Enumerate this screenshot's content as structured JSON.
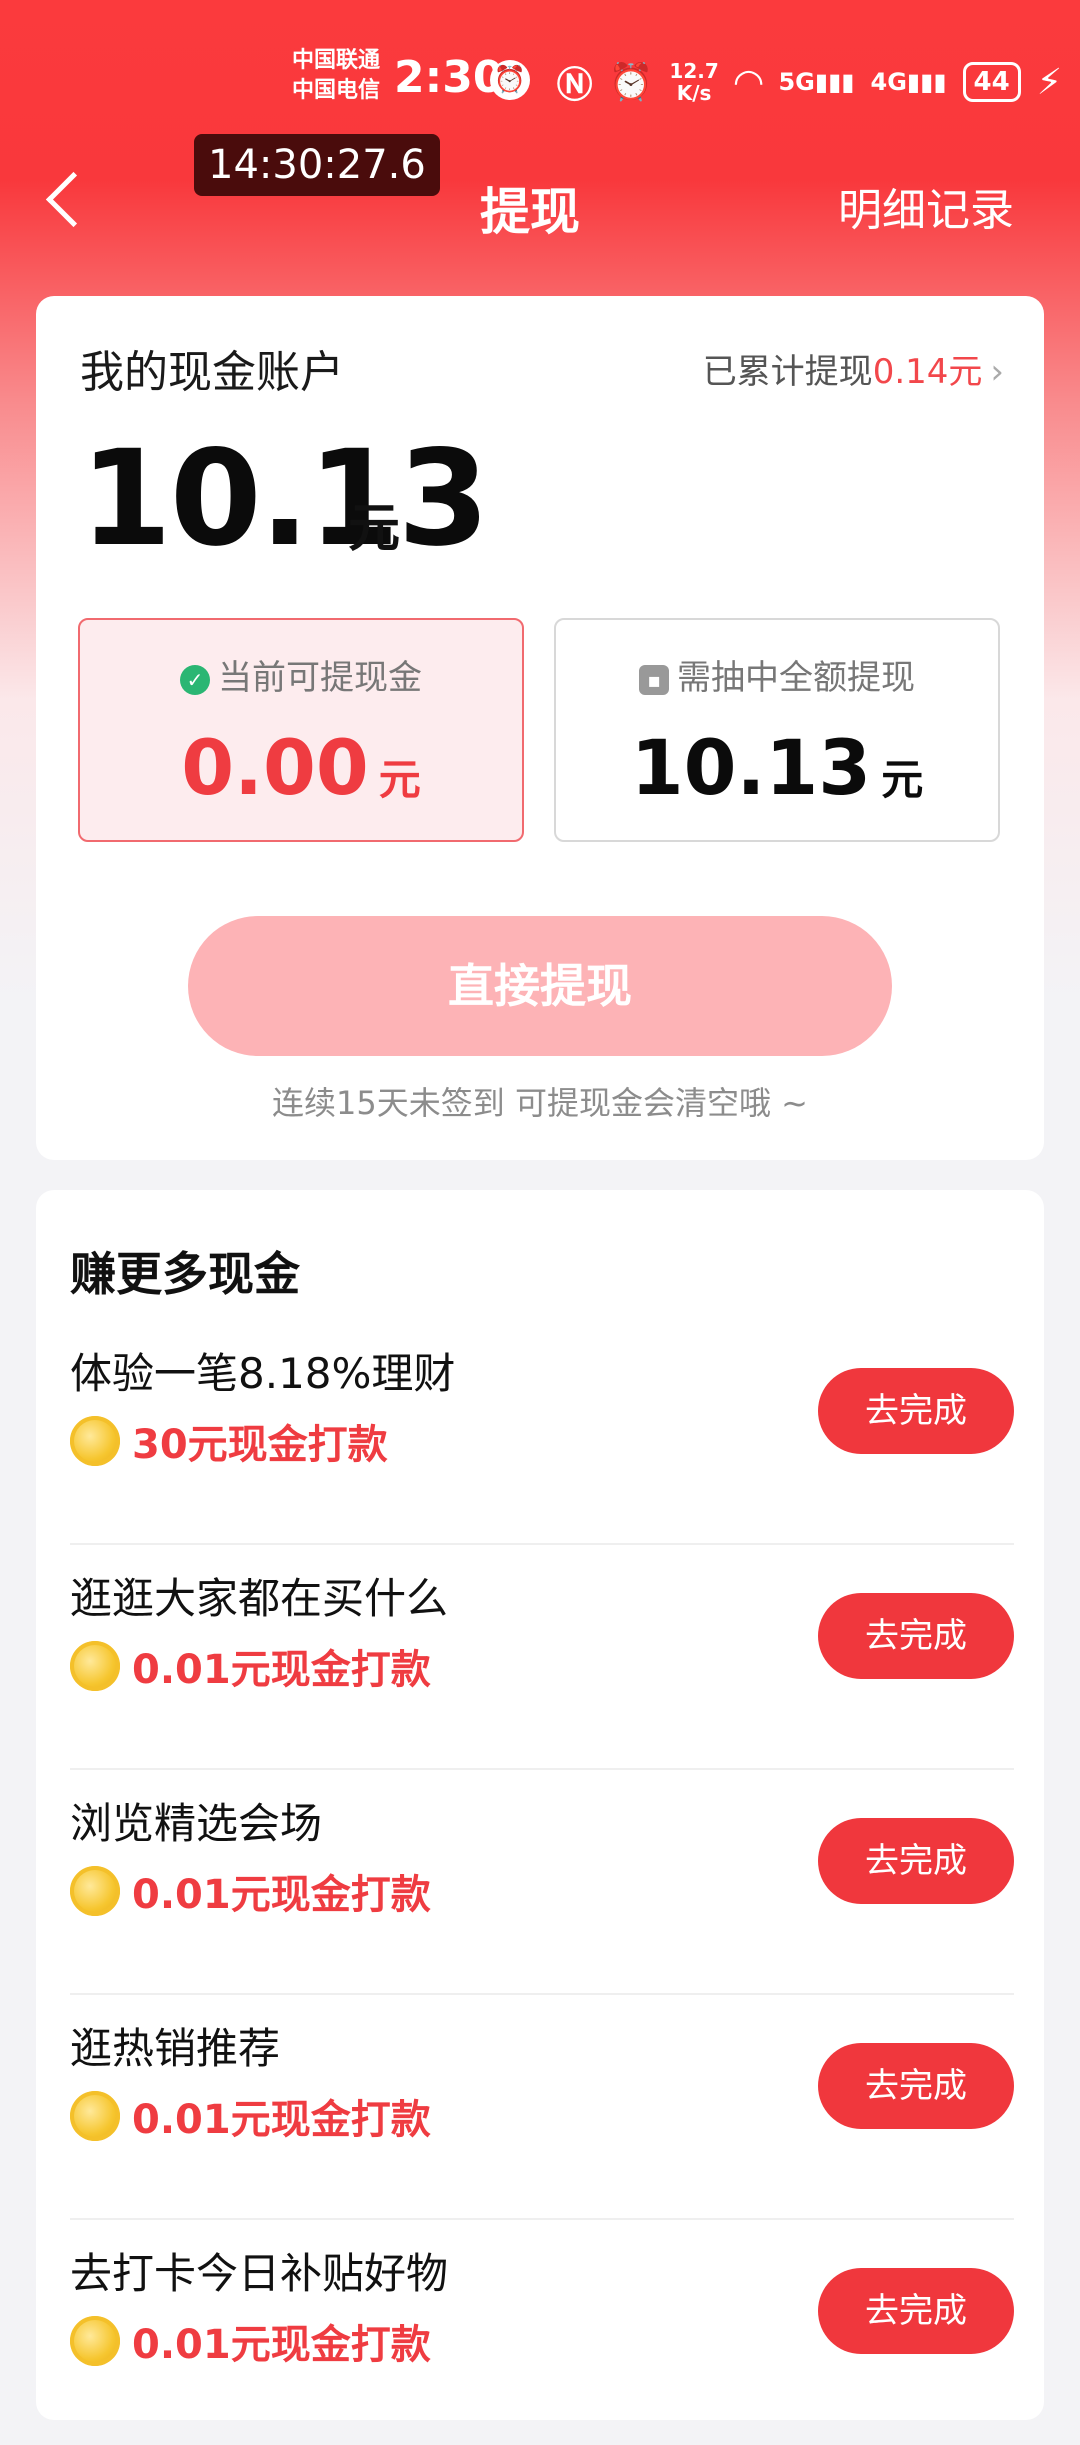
{
  "status_bar": {
    "carrier_1": "中国联通",
    "carrier_2": "中国电信",
    "time": "2:30",
    "net_speed_value": "12.7",
    "net_speed_unit": "K/s",
    "signal_1": "5G",
    "signal_2": "4G",
    "battery": "44"
  },
  "nav": {
    "timer": "14:30:27.6",
    "title": "提现",
    "detail_link": "明细记录"
  },
  "account": {
    "title": "我的现金账户",
    "total_withdrawn_label": "已累计提现",
    "total_withdrawn_value": "0.14元",
    "balance": "10.13",
    "balance_unit": "元",
    "available": {
      "label": "当前可提现金",
      "value": "0.00",
      "unit": "元"
    },
    "locked": {
      "label": "需抽中全额提现",
      "value": "10.13",
      "unit": "元"
    },
    "withdraw_button": "直接提现",
    "warning": "连续15天未签到 可提现金会清空哦 ~"
  },
  "tasks": {
    "title": "赚更多现金",
    "items": [
      {
        "name": "体验一笔8.18%理财",
        "reward": "30元现金打款",
        "button": "去完成"
      },
      {
        "name": "逛逛大家都在买什么",
        "reward": "0.01元现金打款",
        "button": "去完成"
      },
      {
        "name": "浏览精选会场",
        "reward": "0.01元现金打款",
        "button": "去完成"
      },
      {
        "name": "逛热销推荐",
        "reward": "0.01元现金打款",
        "button": "去完成"
      },
      {
        "name": "去打卡今日补贴好物",
        "reward": "0.01元现金打款",
        "button": "去完成"
      }
    ]
  },
  "colors": {
    "accent_red": "#f0373d",
    "disabled_button": "#fdb3b6"
  }
}
